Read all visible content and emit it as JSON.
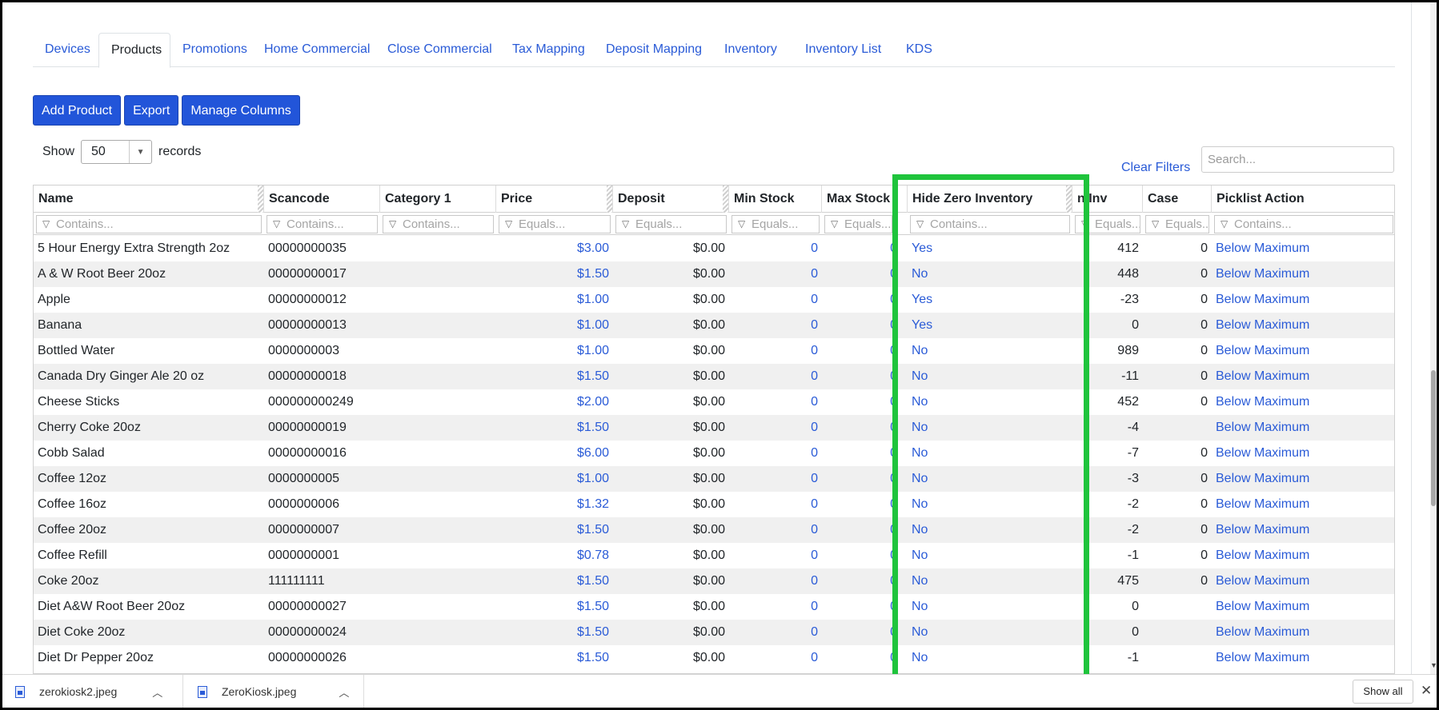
{
  "tabs": [
    "Devices",
    "Products",
    "Promotions",
    "Home Commercial",
    "Close Commercial",
    "Tax Mapping",
    "Deposit Mapping",
    "Inventory",
    "Inventory List",
    "KDS"
  ],
  "active_tab": "Products",
  "toolbar": {
    "add_label": "Add Product",
    "export_label": "Export",
    "manage_label": "Manage Columns"
  },
  "show": {
    "prefix": "Show",
    "value": "50",
    "suffix": "records"
  },
  "clear_filters": "Clear Filters",
  "search_placeholder": "Search...",
  "columns": [
    "Name",
    "Scancode",
    "Category 1",
    "Price",
    "Deposit",
    "Min Stock",
    "Max Stock",
    "",
    "Hide Zero Inventory",
    "n Inv",
    "Case",
    "Picklist Action"
  ],
  "filters": [
    "Contains...",
    "Contains...",
    "Contains...",
    "Equals...",
    "Equals...",
    "Equals...",
    "Equals...",
    "",
    "Contains...",
    "Equals...",
    "Equals...",
    "Contains..."
  ],
  "rows": [
    {
      "name": "5 Hour Energy Extra Strength 2oz",
      "scancode": "00000000035",
      "category": "",
      "price": "$3.00",
      "deposit": "$0.00",
      "min": "0",
      "max": "0",
      "hide": "Yes",
      "inv": "412",
      "case": "0",
      "action": "Below Maximum"
    },
    {
      "name": "A & W Root Beer 20oz",
      "scancode": "00000000017",
      "category": "",
      "price": "$1.50",
      "deposit": "$0.00",
      "min": "0",
      "max": "0",
      "hide": "No",
      "inv": "448",
      "case": "0",
      "action": "Below Maximum"
    },
    {
      "name": "Apple",
      "scancode": "00000000012",
      "category": "",
      "price": "$1.00",
      "deposit": "$0.00",
      "min": "0",
      "max": "0",
      "hide": "Yes",
      "inv": "-23",
      "case": "0",
      "action": "Below Maximum"
    },
    {
      "name": "Banana",
      "scancode": "00000000013",
      "category": "",
      "price": "$1.00",
      "deposit": "$0.00",
      "min": "0",
      "max": "0",
      "hide": "Yes",
      "inv": "0",
      "case": "0",
      "action": "Below Maximum"
    },
    {
      "name": "Bottled Water",
      "scancode": "0000000003",
      "category": "",
      "price": "$1.00",
      "deposit": "$0.00",
      "min": "0",
      "max": "0",
      "hide": "No",
      "inv": "989",
      "case": "0",
      "action": "Below Maximum"
    },
    {
      "name": "Canada Dry Ginger Ale 20 oz",
      "scancode": "00000000018",
      "category": "",
      "price": "$1.50",
      "deposit": "$0.00",
      "min": "0",
      "max": "0",
      "hide": "No",
      "inv": "-11",
      "case": "0",
      "action": "Below Maximum"
    },
    {
      "name": "Cheese Sticks",
      "scancode": "000000000249",
      "category": "",
      "price": "$2.00",
      "deposit": "$0.00",
      "min": "0",
      "max": "0",
      "hide": "No",
      "inv": "452",
      "case": "0",
      "action": "Below Maximum"
    },
    {
      "name": "Cherry Coke 20oz",
      "scancode": "00000000019",
      "category": "",
      "price": "$1.50",
      "deposit": "$0.00",
      "min": "0",
      "max": "0",
      "hide": "No",
      "inv": "-4",
      "case": "",
      "action": "Below Maximum"
    },
    {
      "name": "Cobb Salad",
      "scancode": "00000000016",
      "category": "",
      "price": "$6.00",
      "deposit": "$0.00",
      "min": "0",
      "max": "0",
      "hide": "No",
      "inv": "-7",
      "case": "0",
      "action": "Below Maximum"
    },
    {
      "name": "Coffee 12oz",
      "scancode": "0000000005",
      "category": "",
      "price": "$1.00",
      "deposit": "$0.00",
      "min": "0",
      "max": "0",
      "hide": "No",
      "inv": "-3",
      "case": "0",
      "action": "Below Maximum"
    },
    {
      "name": "Coffee 16oz",
      "scancode": "0000000006",
      "category": "",
      "price": "$1.32",
      "deposit": "$0.00",
      "min": "0",
      "max": "0",
      "hide": "No",
      "inv": "-2",
      "case": "0",
      "action": "Below Maximum"
    },
    {
      "name": "Coffee 20oz",
      "scancode": "0000000007",
      "category": "",
      "price": "$1.50",
      "deposit": "$0.00",
      "min": "0",
      "max": "0",
      "hide": "No",
      "inv": "-2",
      "case": "0",
      "action": "Below Maximum"
    },
    {
      "name": "Coffee Refill",
      "scancode": "0000000001",
      "category": "",
      "price": "$0.78",
      "deposit": "$0.00",
      "min": "0",
      "max": "0",
      "hide": "No",
      "inv": "-1",
      "case": "0",
      "action": "Below Maximum"
    },
    {
      "name": "Coke 20oz",
      "scancode": "111111111",
      "category": "",
      "price": "$1.50",
      "deposit": "$0.00",
      "min": "0",
      "max": "0",
      "hide": "No",
      "inv": "475",
      "case": "0",
      "action": "Below Maximum"
    },
    {
      "name": "Diet A&W Root Beer 20oz",
      "scancode": "00000000027",
      "category": "",
      "price": "$1.50",
      "deposit": "$0.00",
      "min": "0",
      "max": "0",
      "hide": "No",
      "inv": "0",
      "case": "",
      "action": "Below Maximum"
    },
    {
      "name": "Diet Coke 20oz",
      "scancode": "00000000024",
      "category": "",
      "price": "$1.50",
      "deposit": "$0.00",
      "min": "0",
      "max": "0",
      "hide": "No",
      "inv": "0",
      "case": "",
      "action": "Below Maximum"
    },
    {
      "name": "Diet Dr Pepper 20oz",
      "scancode": "00000000026",
      "category": "",
      "price": "$1.50",
      "deposit": "$0.00",
      "min": "0",
      "max": "0",
      "hide": "No",
      "inv": "-1",
      "case": "",
      "action": "Below Maximum"
    }
  ],
  "downloads": [
    {
      "file": "zerokiosk2.jpeg"
    },
    {
      "file": "ZeroKiosk.jpeg"
    }
  ],
  "show_all_label": "Show all",
  "colors": {
    "accent": "#2255d9",
    "link": "#2a5bd7",
    "highlight": "#1fc43c"
  }
}
